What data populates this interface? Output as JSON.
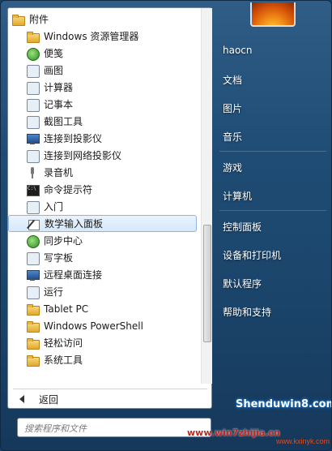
{
  "program_list": {
    "items": [
      {
        "label": "附件",
        "type": "folder",
        "icon": "folder-icon"
      },
      {
        "label": "Windows 资源管理器",
        "type": "item",
        "icon": "explorer-icon"
      },
      {
        "label": "便笺",
        "type": "item",
        "icon": "sticky-notes-icon"
      },
      {
        "label": "画图",
        "type": "item",
        "icon": "paint-icon"
      },
      {
        "label": "计算器",
        "type": "item",
        "icon": "calculator-icon"
      },
      {
        "label": "记事本",
        "type": "item",
        "icon": "notepad-icon"
      },
      {
        "label": "截图工具",
        "type": "item",
        "icon": "snipping-tool-icon"
      },
      {
        "label": "连接到投影仪",
        "type": "item",
        "icon": "projector-icon"
      },
      {
        "label": "连接到网络投影仪",
        "type": "item",
        "icon": "network-projector-icon"
      },
      {
        "label": "录音机",
        "type": "item",
        "icon": "microphone-icon"
      },
      {
        "label": "命令提示符",
        "type": "item",
        "icon": "command-prompt-icon"
      },
      {
        "label": "入门",
        "type": "item",
        "icon": "getting-started-icon"
      },
      {
        "label": "数学输入面板",
        "type": "item",
        "icon": "math-input-icon",
        "highlighted": true
      },
      {
        "label": "同步中心",
        "type": "item",
        "icon": "sync-center-icon"
      },
      {
        "label": "写字板",
        "type": "item",
        "icon": "wordpad-icon"
      },
      {
        "label": "远程桌面连接",
        "type": "item",
        "icon": "remote-desktop-icon"
      },
      {
        "label": "运行",
        "type": "item",
        "icon": "run-icon"
      },
      {
        "label": "Tablet PC",
        "type": "item",
        "icon": "folder-icon"
      },
      {
        "label": "Windows PowerShell",
        "type": "item",
        "icon": "folder-icon"
      },
      {
        "label": "轻松访问",
        "type": "item",
        "icon": "folder-icon"
      },
      {
        "label": "系统工具",
        "type": "item",
        "icon": "folder-icon"
      }
    ]
  },
  "back_label": "返回",
  "search_placeholder": "搜索程序和文件",
  "right_pane": {
    "items": [
      "haocn",
      "文档",
      "图片",
      "音乐",
      "游戏",
      "计算机",
      "控制面板",
      "设备和打印机",
      "默认程序",
      "帮助和支持"
    ]
  },
  "watermark": "www.win7zhijia.cn",
  "logo": "Shenduwin8.com",
  "logo_sub": "www.kxinyk.com",
  "colors": {
    "highlight_border": "#8fb5dc",
    "accent_blue": "#1f4c74"
  }
}
